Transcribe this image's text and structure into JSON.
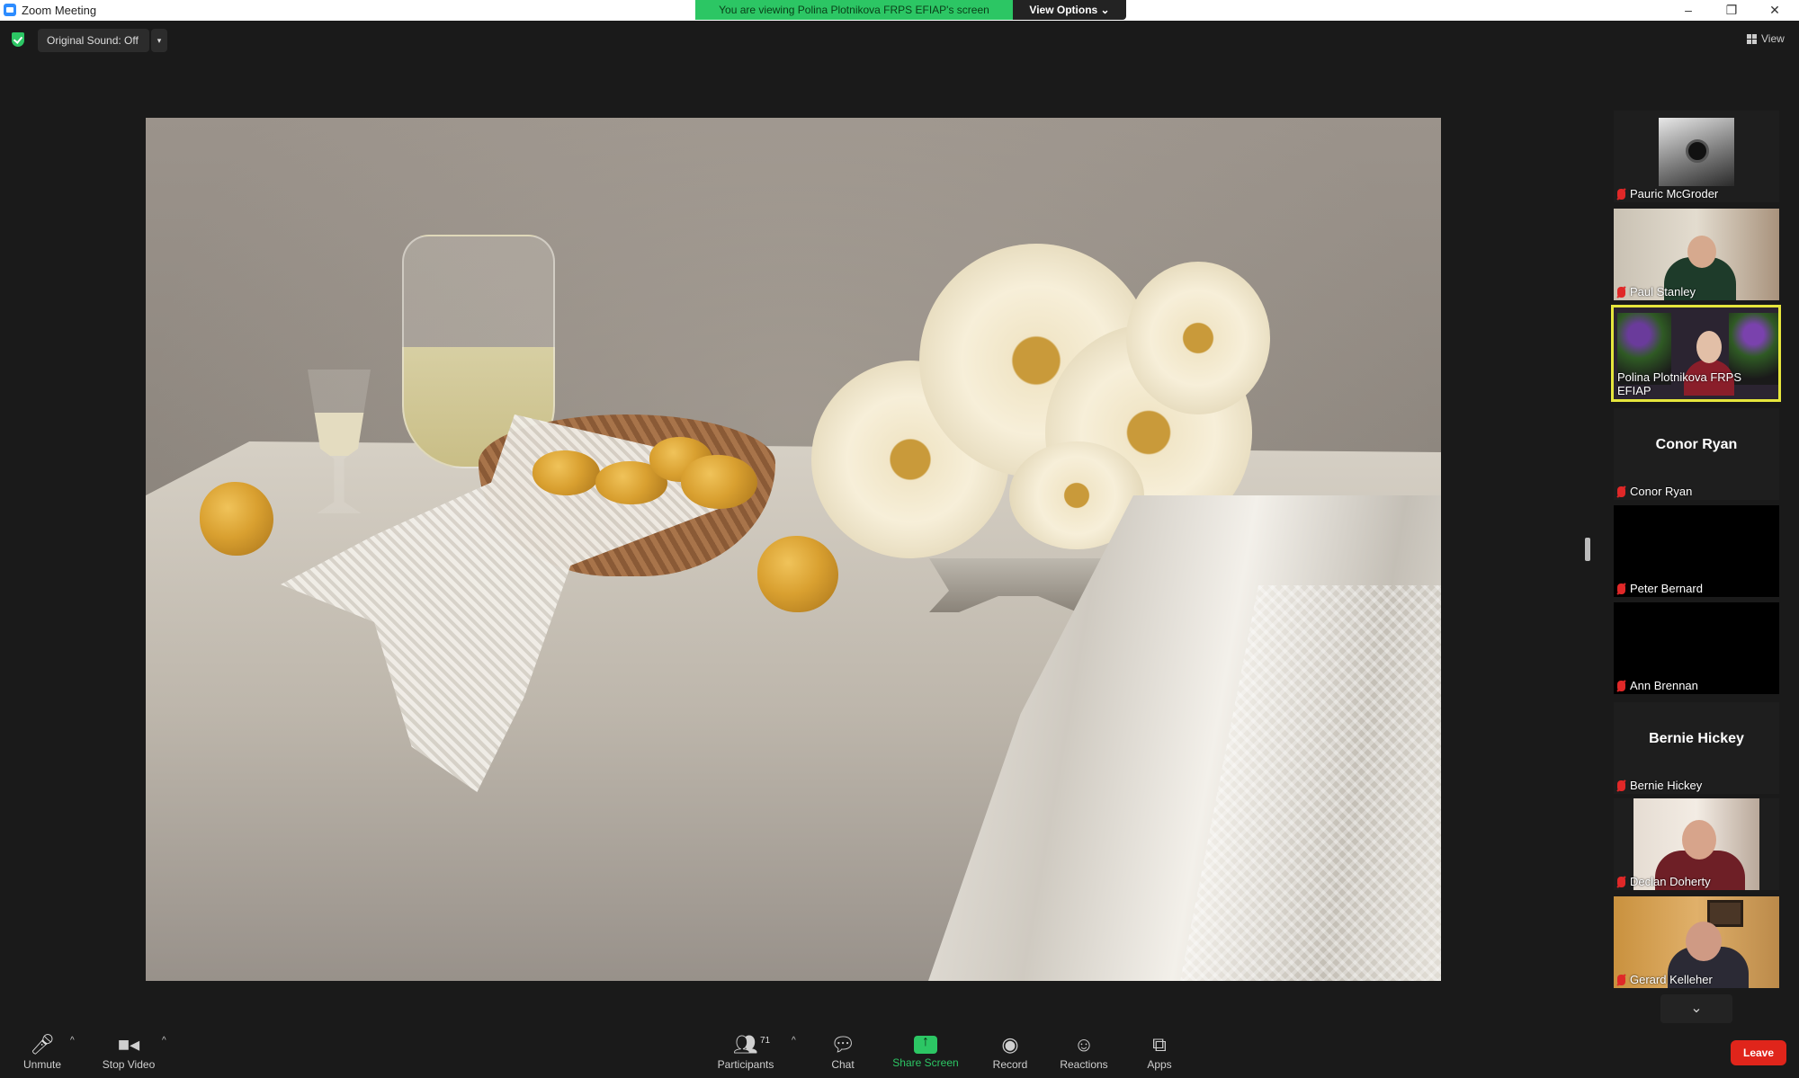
{
  "window": {
    "title": "Zoom Meeting",
    "share_banner": "You are viewing Polina Plotnikova FRPS EFIAP's screen",
    "view_options": "View Options ⌄",
    "minimize": "–",
    "restore": "❐",
    "close": "✕"
  },
  "top_toolbar": {
    "original_sound": "Original Sound: Off",
    "caret": "▾",
    "view": "View"
  },
  "participants_panel": {
    "tiles": [
      {
        "name": "Pauric McGroder",
        "type": "video"
      },
      {
        "name": "Paul Stanley",
        "type": "video"
      },
      {
        "name": "Polina Plotnikova FRPS EFIAP",
        "type": "video",
        "active": true
      },
      {
        "name": "Conor Ryan",
        "type": "name-only",
        "big_name": "Conor Ryan"
      },
      {
        "name": "Peter Bernard",
        "type": "black"
      },
      {
        "name": "Ann Brennan",
        "type": "black"
      },
      {
        "name": "Bernie Hickey",
        "type": "name-only",
        "big_name": "Bernie Hickey"
      },
      {
        "name": "Declan Doherty",
        "type": "video"
      },
      {
        "name": "Gerard Kelleher",
        "type": "video"
      }
    ],
    "scroll_down": "⌄"
  },
  "bottom_toolbar": {
    "unmute": "Unmute",
    "stop_video": "Stop Video",
    "participants": "Participants",
    "participant_count": "71",
    "chat": "Chat",
    "share_screen": "Share Screen",
    "record": "Record",
    "reactions": "Reactions",
    "apps": "Apps",
    "leave": "Leave",
    "caret": "^"
  },
  "colors": {
    "share_banner": "#2cc664",
    "leave": "#e0251b",
    "active_speaker_border": "#e6e63c",
    "muted_mic": "#e02828"
  }
}
